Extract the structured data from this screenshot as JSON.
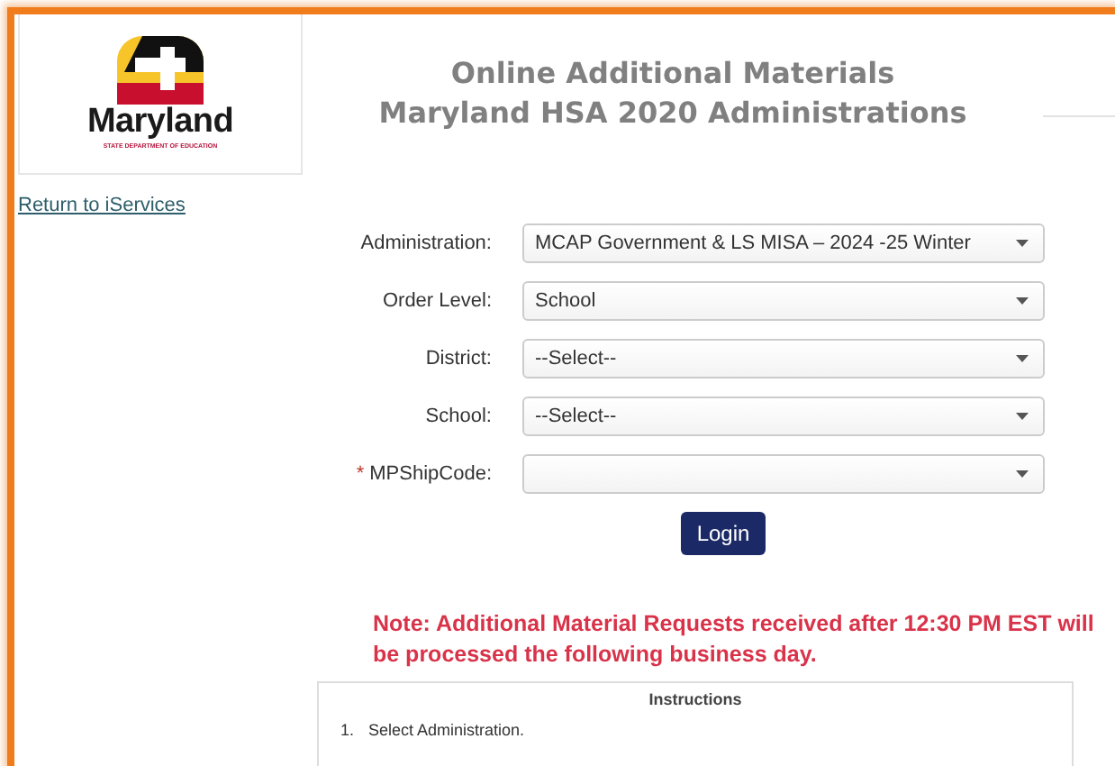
{
  "logo": {
    "name": "Maryland",
    "subtitle": "STATE DEPARTMENT OF EDUCATION"
  },
  "title": [
    "Online Additional Materials",
    "Maryland HSA 2020 Administrations"
  ],
  "return_link": "Return to iServices",
  "fields": [
    {
      "label": "Administration:",
      "value": "MCAP Government & LS MISA – 2024 -25 Winter"
    },
    {
      "label": "Order Level:",
      "value": "School"
    },
    {
      "label": "District:",
      "value": "--Select--"
    },
    {
      "label": "School:",
      "value": "--Select--"
    },
    {
      "label": "MPShipCode:",
      "required_mark": "*"
    }
  ],
  "login_button": "Login",
  "note": "Note: Additional Material Requests received after 12:30 PM EST will be processed the following business day.",
  "instructions": {
    "title": "Instructions",
    "steps": [
      {
        "number": "1.",
        "text": "Select Administration."
      }
    ]
  }
}
